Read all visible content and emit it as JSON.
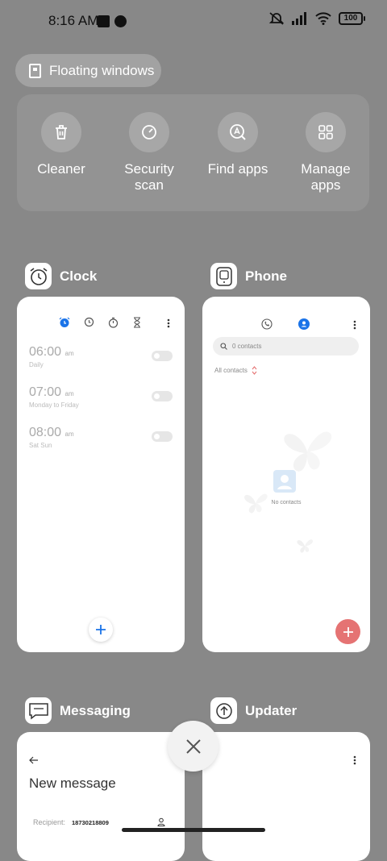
{
  "status_bar": {
    "time": "8:16 AM",
    "battery": "100"
  },
  "floating_windows_label": "Floating windows",
  "actions": [
    {
      "label": "Cleaner",
      "icon": "trash-icon"
    },
    {
      "label": "Security scan",
      "icon": "security-scan-icon"
    },
    {
      "label": "Find apps",
      "icon": "find-apps-icon"
    },
    {
      "label": "Manage apps",
      "icon": "grid-icon"
    }
  ],
  "apps": {
    "clock": {
      "name": "Clock",
      "alarms": [
        {
          "time": "06:00",
          "ampm": "am",
          "repeat": "Daily"
        },
        {
          "time": "07:00",
          "ampm": "am",
          "repeat": "Monday to Friday"
        },
        {
          "time": "08:00",
          "ampm": "am",
          "repeat": "Sat Sun"
        }
      ]
    },
    "phone": {
      "name": "Phone",
      "search_placeholder": "0 contacts",
      "filter_label": "All contacts",
      "empty_label": "No contacts"
    },
    "messaging": {
      "name": "Messaging",
      "title": "New message",
      "recipient_label": "Recipient:",
      "recipient_value": "18730218809"
    },
    "updater": {
      "name": "Updater"
    }
  },
  "colors": {
    "background": "#888888",
    "accent_blue": "#1a73e8",
    "fab_red": "#e57373"
  }
}
